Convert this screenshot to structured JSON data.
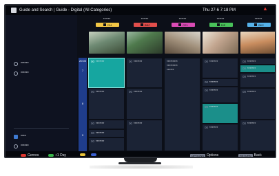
{
  "header": {
    "title": "Guide and Search | Guide - Digital (All Categories)",
    "clock": "Thu 27-6 7:18 PM"
  },
  "channels": [
    {
      "name": "******",
      "badge": "204",
      "color": "#f2c645"
    },
    {
      "name": "******",
      "badge": "BBC",
      "color": "#e24e4b"
    },
    {
      "name": "******",
      "badge": "CE1",
      "color": "#d94bb4"
    },
    {
      "name": "******",
      "badge": "DIE",
      "color": "#49c25a"
    },
    {
      "name": "******",
      "badge": "BK2",
      "color": "#56b2ea"
    }
  ],
  "timeline": [
    "20:00",
    "7",
    "8",
    "9"
  ],
  "left_menu": {
    "top_items": [
      "******",
      "******"
    ],
    "bottom_items": [
      "****",
      "******"
    ]
  },
  "grid": {
    "col1": [
      {
        "time": "00",
        "title": "*******"
      },
      {
        "time": "00",
        "title": "*******"
      },
      {
        "time": "00",
        "title": "*******"
      },
      {
        "time": "00",
        "title": "*******"
      },
      {
        "time": "00",
        "title": "*******"
      }
    ],
    "col2": [
      {
        "time": "00",
        "title": "*******"
      },
      {
        "time": "00",
        "title": "*******"
      },
      {
        "time": "00",
        "title": "*******"
      }
    ],
    "col3": [
      {
        "time": "",
        "title": "*********"
      },
      {
        "time": "",
        "title": "*********"
      },
      {
        "time": "",
        "title": "******"
      }
    ],
    "col4": [
      {
        "time": "00",
        "title": "*******"
      },
      {
        "time": "00",
        "title": "*******"
      },
      {
        "time": "00",
        "title": "*******"
      },
      {
        "time": "00",
        "title": "*******"
      },
      {
        "time": "00",
        "title": "*******"
      }
    ],
    "col5": [
      {
        "time": "00",
        "title": "*******"
      },
      {
        "time": "00",
        "title": "*******"
      },
      {
        "time": "00",
        "title": "*******"
      },
      {
        "time": "00",
        "title": "*******"
      },
      {
        "time": "00",
        "title": "*******"
      }
    ]
  },
  "footer": {
    "red_label": "Genres",
    "green_label": "+1 Day",
    "options_key": "OPTIONS",
    "options_label": "Options",
    "return_key": "RETURN",
    "return_label": "Back"
  },
  "colors": {
    "selected": "#16a6a0",
    "time_bar": "#1f3d8c"
  }
}
